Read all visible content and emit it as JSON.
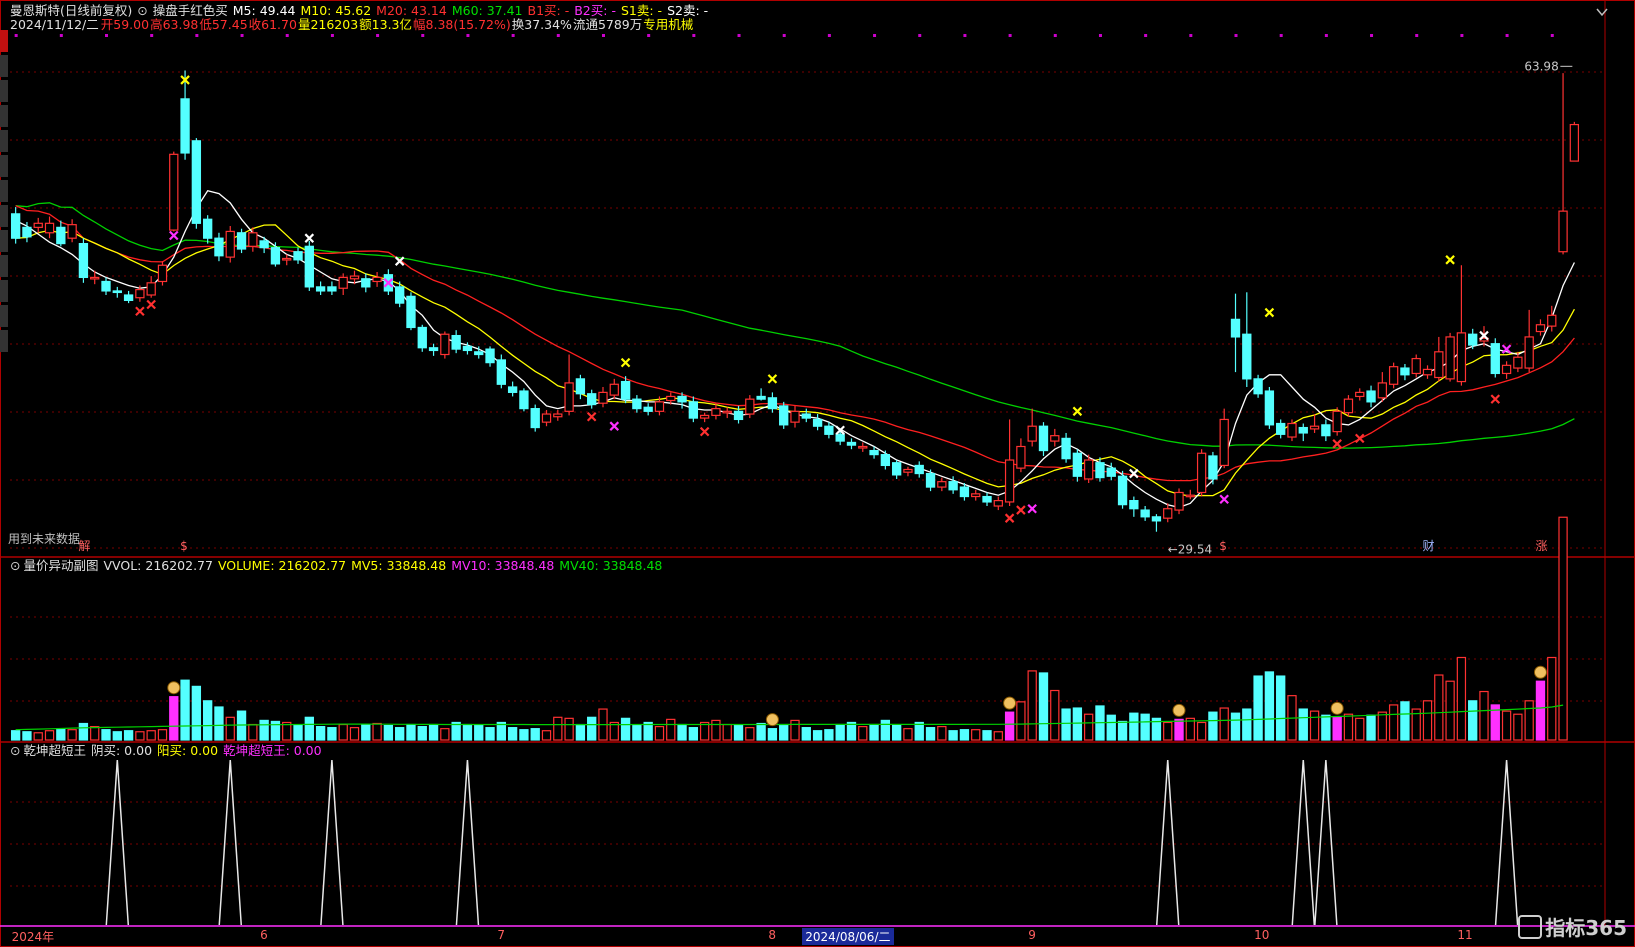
{
  "colors": {
    "up": "#ff3232",
    "down": "#54ffff",
    "ma5": "#ffffff",
    "ma10": "#ffff00",
    "ma20": "#ff2020",
    "ma60": "#00d000",
    "grid": "#7a0000",
    "sep": "#b00000",
    "vol_ma": "#00d000",
    "label": "#c8c8c8",
    "sig_cross": "#ffff00",
    "sig_buy": "#ff3030",
    "sig_pink": "#ff30ff"
  },
  "header": {
    "title": "曼恩斯特(日线前复权)",
    "indicator_name": "操盘手红色买",
    "ma5": "M5: 49.44",
    "ma10": "M10: 45.62",
    "ma20": "M20: 43.14",
    "ma60": "M60: 37.41",
    "b1": "B1买: -",
    "b2": "B2买: -",
    "s1": "S1卖: -",
    "s2": "S2卖: -",
    "date": "2024/11/12/二",
    "open": "开59.00",
    "high": "高63.98",
    "low": "低57.45",
    "close": "收61.70",
    "volume": "量216203",
    "amount": "额13.3亿",
    "change": "幅8.38(15.72%)",
    "turnover": "换37.34%",
    "float": "流通5789万",
    "industry": "专用机械"
  },
  "volume_header": {
    "name": "量价异动副图",
    "vvol": "VVOL: 216202.77",
    "volume": "VOLUME: 216202.77",
    "mv5": "MV5: 33848.48",
    "mv10": "MV10: 33848.48",
    "mv40": "MV40: 33848.48"
  },
  "osc_header": {
    "name": "乾坤超短王",
    "yin": "阴买: 0.00",
    "yang": "阳买: 0.00",
    "king": "乾坤超短王: 0.00"
  },
  "future_note": "用到未来数据",
  "x_axis_labels": [
    {
      "label": "2024年",
      "i": 0
    },
    {
      "label": "6",
      "i": 22
    },
    {
      "label": "7",
      "i": 43
    },
    {
      "label": "8",
      "i": 67
    },
    {
      "label": "2024/08/06/二",
      "i": 70,
      "sel": true
    },
    {
      "label": "9",
      "i": 90
    },
    {
      "label": "10",
      "i": 110
    },
    {
      "label": "11",
      "i": 128
    }
  ],
  "bottom_tags": [
    {
      "label": "解",
      "i": 6
    },
    {
      "label": "$",
      "i": 15
    },
    {
      "label": "$",
      "i": 107
    },
    {
      "label": "财",
      "i": 125
    },
    {
      "label": "涨",
      "i": 135
    }
  ],
  "price_labels": {
    "high": "63.98",
    "low": "29.54"
  },
  "side_tabs": [
    true,
    false,
    false,
    false,
    false,
    false,
    false,
    false,
    false,
    false,
    false,
    false,
    false
  ],
  "watermark": "指标365",
  "chart_data": {
    "type": "candlestick",
    "ylim": [
      28.0,
      66.0
    ],
    "candles": [
      [
        53.0,
        51.2,
        53.5,
        50.8
      ],
      [
        52.0,
        51.3,
        52.4,
        50.9
      ],
      [
        52.0,
        52.3,
        52.7,
        51.6
      ],
      [
        51.6,
        52.3,
        52.8,
        51.2
      ],
      [
        52.0,
        50.8,
        52.5,
        50.6
      ],
      [
        51.2,
        52.2,
        52.6,
        50.9
      ],
      [
        50.8,
        48.3,
        51.2,
        47.9
      ],
      [
        48.3,
        48.3,
        48.8,
        47.8
      ],
      [
        48.0,
        47.3,
        48.3,
        47.0
      ],
      [
        47.3,
        47.2,
        47.6,
        46.8
      ],
      [
        47.0,
        46.6,
        47.3,
        46.4
      ],
      [
        46.8,
        47.4,
        47.7,
        46.5
      ],
      [
        47.0,
        47.9,
        48.4,
        46.8
      ],
      [
        48.0,
        49.2,
        49.5,
        47.7
      ],
      [
        51.8,
        57.4,
        57.6,
        51.7
      ],
      [
        61.5,
        57.5,
        63.6,
        57.0
      ],
      [
        58.4,
        52.3,
        58.6,
        51.9
      ],
      [
        52.6,
        51.2,
        52.9,
        50.8
      ],
      [
        51.2,
        49.9,
        51.6,
        49.5
      ],
      [
        49.8,
        51.7,
        52.1,
        49.4
      ],
      [
        51.6,
        50.4,
        51.9,
        50.1
      ],
      [
        50.6,
        51.6,
        52.0,
        50.2
      ],
      [
        51.0,
        50.5,
        51.3,
        50.1
      ],
      [
        50.5,
        49.3,
        50.9,
        49.1
      ],
      [
        49.6,
        49.7,
        50.0,
        49.2
      ],
      [
        50.2,
        49.6,
        50.5,
        49.3
      ],
      [
        50.6,
        47.6,
        51.0,
        47.3
      ],
      [
        47.6,
        47.3,
        48.0,
        47.0
      ],
      [
        47.6,
        47.3,
        48.0,
        47.0
      ],
      [
        47.5,
        48.3,
        48.6,
        47.0
      ],
      [
        48.2,
        48.4,
        48.8,
        47.8
      ],
      [
        48.2,
        47.6,
        48.6,
        47.2
      ],
      [
        48.0,
        48.3,
        48.7,
        47.6
      ],
      [
        48.5,
        47.3,
        48.9,
        47.0
      ],
      [
        47.6,
        46.4,
        48.0,
        46.1
      ],
      [
        46.9,
        44.6,
        47.2,
        44.4
      ],
      [
        44.6,
        43.1,
        44.8,
        42.8
      ],
      [
        43.1,
        42.9,
        43.4,
        42.5
      ],
      [
        42.6,
        44.1,
        44.3,
        42.3
      ],
      [
        44.0,
        43.0,
        44.4,
        42.7
      ],
      [
        43.2,
        42.9,
        43.5,
        42.6
      ],
      [
        42.8,
        42.6,
        43.2,
        42.3
      ],
      [
        43.0,
        42.0,
        43.2,
        41.7
      ],
      [
        42.2,
        40.4,
        42.6,
        40.1
      ],
      [
        40.2,
        39.8,
        40.6,
        39.5
      ],
      [
        39.9,
        38.6,
        40.1,
        38.4
      ],
      [
        38.6,
        37.2,
        38.9,
        36.9
      ],
      [
        37.6,
        38.2,
        38.5,
        37.3
      ],
      [
        38.0,
        38.2,
        38.5,
        37.7
      ],
      [
        38.4,
        40.5,
        42.6,
        38.1
      ],
      [
        40.8,
        39.7,
        41.1,
        39.3
      ],
      [
        39.7,
        38.9,
        40.0,
        38.6
      ],
      [
        39.0,
        39.8,
        40.2,
        38.7
      ],
      [
        39.6,
        40.4,
        40.8,
        39.3
      ],
      [
        40.6,
        39.3,
        41.0,
        39.0
      ],
      [
        39.3,
        38.6,
        39.6,
        38.3
      ],
      [
        38.7,
        38.4,
        39.0,
        38.1
      ],
      [
        38.4,
        39.1,
        39.5,
        38.1
      ],
      [
        39.2,
        39.5,
        39.8,
        38.9
      ],
      [
        39.5,
        39.1,
        39.8,
        38.6
      ],
      [
        39.1,
        37.9,
        39.5,
        37.6
      ],
      [
        37.9,
        38.1,
        38.3,
        37.6
      ],
      [
        38.1,
        38.6,
        39.0,
        37.8
      ],
      [
        38.3,
        38.4,
        38.7,
        37.9
      ],
      [
        38.4,
        37.8,
        38.8,
        37.5
      ],
      [
        38.2,
        39.3,
        39.6,
        37.9
      ],
      [
        39.5,
        39.3,
        40.1,
        39.2
      ],
      [
        39.4,
        38.6,
        39.8,
        38.3
      ],
      [
        38.8,
        37.4,
        39.1,
        37.1
      ],
      [
        37.6,
        38.4,
        38.8,
        37.2
      ],
      [
        38.2,
        37.9,
        38.6,
        37.6
      ],
      [
        37.8,
        37.3,
        38.2,
        37.0
      ],
      [
        37.3,
        36.7,
        37.6,
        36.4
      ],
      [
        36.7,
        36.2,
        37.0,
        35.9
      ],
      [
        36.1,
        35.9,
        36.4,
        35.6
      ],
      [
        35.8,
        35.8,
        36.1,
        35.4
      ],
      [
        35.5,
        35.2,
        35.8,
        34.9
      ],
      [
        35.2,
        34.4,
        35.5,
        34.1
      ],
      [
        34.6,
        33.7,
        34.8,
        33.4
      ],
      [
        33.9,
        34.1,
        34.3,
        33.6
      ],
      [
        34.4,
        33.8,
        34.7,
        33.5
      ],
      [
        33.8,
        32.8,
        34.1,
        32.5
      ],
      [
        32.8,
        33.2,
        33.5,
        32.5
      ],
      [
        33.2,
        32.6,
        33.6,
        32.3
      ],
      [
        32.8,
        32.1,
        33.1,
        31.8
      ],
      [
        32.1,
        32.3,
        32.6,
        31.8
      ],
      [
        32.1,
        31.7,
        32.4,
        31.4
      ],
      [
        31.4,
        31.8,
        32.1,
        31.1
      ],
      [
        31.7,
        34.8,
        37.8,
        31.4
      ],
      [
        34.2,
        35.8,
        36.4,
        33.9
      ],
      [
        36.2,
        37.3,
        38.6,
        35.8
      ],
      [
        37.3,
        35.5,
        37.6,
        35.1
      ],
      [
        36.2,
        36.6,
        37.1,
        35.8
      ],
      [
        36.4,
        34.9,
        36.8,
        34.6
      ],
      [
        35.3,
        33.6,
        35.6,
        33.2
      ],
      [
        33.4,
        34.8,
        35.2,
        33.1
      ],
      [
        34.6,
        33.5,
        35.0,
        33.2
      ],
      [
        34.2,
        33.6,
        34.6,
        33.3
      ],
      [
        33.6,
        31.5,
        34.0,
        31.2
      ],
      [
        31.8,
        31.2,
        32.1,
        30.6
      ],
      [
        31.1,
        30.6,
        31.4,
        30.3
      ],
      [
        30.6,
        30.3,
        30.8,
        29.5
      ],
      [
        30.5,
        31.2,
        31.6,
        30.2
      ],
      [
        31.1,
        32.4,
        32.7,
        30.8
      ],
      [
        32.2,
        32.2,
        32.6,
        31.9
      ],
      [
        32.4,
        35.3,
        35.6,
        32.1
      ],
      [
        35.1,
        33.4,
        35.4,
        33.0
      ],
      [
        34.4,
        37.8,
        38.6,
        34.2
      ],
      [
        45.2,
        43.9,
        47.1,
        41.3
      ],
      [
        44.1,
        40.8,
        47.2,
        40.2
      ],
      [
        40.8,
        39.7,
        41.1,
        39.4
      ],
      [
        39.9,
        37.4,
        40.2,
        37.1
      ],
      [
        37.5,
        36.7,
        37.8,
        36.4
      ],
      [
        36.5,
        37.5,
        37.8,
        36.2
      ],
      [
        37.2,
        36.8,
        37.5,
        36.2
      ],
      [
        37.1,
        37.3,
        38.2,
        36.8
      ],
      [
        37.4,
        36.6,
        37.8,
        36.2
      ],
      [
        36.9,
        38.4,
        38.7,
        36.6
      ],
      [
        38.3,
        39.3,
        39.6,
        38.0
      ],
      [
        39.5,
        39.8,
        40.1,
        39.2
      ],
      [
        39.9,
        39.1,
        40.3,
        38.7
      ],
      [
        39.4,
        40.5,
        41.3,
        39.1
      ],
      [
        40.4,
        41.7,
        42.0,
        40.1
      ],
      [
        41.6,
        41.1,
        41.9,
        40.7
      ],
      [
        41.2,
        42.3,
        42.6,
        40.9
      ],
      [
        41.1,
        41.5,
        41.8,
        40.8
      ],
      [
        40.9,
        42.8,
        43.9,
        40.6
      ],
      [
        40.8,
        43.9,
        44.2,
        40.6
      ],
      [
        40.6,
        44.2,
        49.2,
        40.3
      ],
      [
        44.1,
        43.3,
        44.5,
        43.0
      ],
      [
        43.6,
        43.8,
        44.7,
        43.2
      ],
      [
        43.4,
        41.2,
        43.8,
        40.9
      ],
      [
        41.2,
        41.8,
        42.1,
        40.8
      ],
      [
        41.6,
        42.4,
        42.8,
        41.3
      ],
      [
        41.6,
        43.9,
        45.9,
        41.3
      ],
      [
        44.3,
        44.8,
        45.2,
        44.0
      ],
      [
        44.7,
        45.5,
        46.2,
        44.3
      ],
      [
        50.2,
        53.2,
        63.4,
        50.0
      ],
      [
        56.9,
        59.6,
        59.8,
        57.2
      ]
    ],
    "ma5": [
      52.5,
      52.1,
      51.5,
      50.9,
      50.5,
      50.0,
      49.3,
      48.7,
      48.3,
      48.0,
      47.7,
      47.5,
      47.6,
      48.5,
      49.8,
      51.7,
      53.4,
      54.7,
      54.5,
      53.8,
      52.6,
      51.6,
      51.2,
      50.6,
      50.0,
      49.7,
      49.2,
      48.7,
      48.2,
      48.0,
      47.9,
      48.1,
      48.2,
      48.0,
      47.3,
      46.2,
      45.5,
      44.4,
      43.8,
      43.5,
      43.3,
      43.0,
      42.6,
      41.9,
      41.3,
      40.6,
      39.6,
      38.8,
      38.6,
      38.8,
      38.8,
      38.9,
      39.1,
      39.4,
      39.2,
      39.2,
      39.1,
      39.1,
      39.0,
      38.9,
      38.6,
      38.5,
      38.5,
      38.3,
      38.1,
      38.2,
      38.6,
      38.9,
      38.5,
      38.2,
      38.0,
      37.9,
      37.6,
      37.1,
      36.6,
      36.2,
      35.8,
      35.3,
      34.8,
      34.5,
      34.2,
      33.9,
      33.6,
      33.3,
      33.0,
      32.7,
      32.4,
      32.2,
      32.5,
      33.2,
      34.0,
      34.9,
      35.6,
      36.0,
      35.6,
      35.0,
      34.6,
      34.3,
      33.7,
      33.0,
      32.4,
      31.9,
      31.5,
      31.3,
      31.6,
      32.5,
      33.3,
      34.7,
      37.5,
      39.6,
      40.5,
      41.1,
      41.1,
      40.2,
      39.3,
      38.7,
      37.9,
      37.5,
      37.4,
      37.8,
      38.5,
      39.2,
      39.9,
      40.3,
      40.8,
      41.3,
      41.6,
      42.1,
      42.9,
      43.2,
      43.4,
      43.0,
      42.8,
      42.6,
      43.0,
      43.4,
      45.3,
      47.7,
      49.4
    ]
  },
  "signals": {
    "yellow_x": [
      {
        "i": 15,
        "y": 62.9
      },
      {
        "i": 54,
        "y": 42.0
      },
      {
        "i": 67,
        "y": 40.8
      },
      {
        "i": 94,
        "y": 38.4
      },
      {
        "i": 111,
        "y": 45.7
      },
      {
        "i": 127,
        "y": 49.6
      }
    ],
    "red_x": [
      {
        "i": 11,
        "y": 45.8
      },
      {
        "i": 12,
        "y": 46.3
      },
      {
        "i": 51,
        "y": 38.0
      },
      {
        "i": 61,
        "y": 36.9
      },
      {
        "i": 88,
        "y": 30.5
      },
      {
        "i": 89,
        "y": 31.1
      },
      {
        "i": 117,
        "y": 36.0
      },
      {
        "i": 119,
        "y": 36.4
      },
      {
        "i": 131,
        "y": 39.3
      }
    ],
    "white_x": [
      {
        "i": 26,
        "y": 51.2
      },
      {
        "i": 34,
        "y": 49.5
      },
      {
        "i": 73,
        "y": 37.0
      },
      {
        "i": 99,
        "y": 33.8
      },
      {
        "i": 130,
        "y": 44.0
      }
    ],
    "pink_x": [
      {
        "i": 14,
        "y": 51.4
      },
      {
        "i": 33,
        "y": 47.9
      },
      {
        "i": 53,
        "y": 37.3
      },
      {
        "i": 90,
        "y": 31.2
      },
      {
        "i": 107,
        "y": 31.9
      },
      {
        "i": 132,
        "y": 43.0
      }
    ]
  },
  "volume_data": {
    "ylim": [
      0,
      160000
    ],
    "values": [
      9000,
      8000,
      7000,
      9000,
      11000,
      10000,
      16000,
      13000,
      10000,
      8000,
      9000,
      8000,
      9000,
      10000,
      42000,
      58000,
      52000,
      38000,
      32000,
      22000,
      28000,
      15000,
      19000,
      18000,
      17000,
      14000,
      22000,
      13000,
      12000,
      15000,
      12000,
      15000,
      16000,
      14000,
      12000,
      15000,
      13000,
      15000,
      11000,
      17000,
      15000,
      14000,
      12000,
      17000,
      12000,
      10000,
      11000,
      9000,
      22000,
      21000,
      15000,
      22000,
      30000,
      17000,
      21000,
      14000,
      17000,
      13000,
      20000,
      15000,
      12000,
      17000,
      19000,
      15000,
      14000,
      12000,
      16000,
      11000,
      15000,
      19000,
      12000,
      9000,
      10000,
      15000,
      17000,
      13000,
      15000,
      19000,
      14000,
      11000,
      17000,
      12000,
      13000,
      9000,
      10000,
      10000,
      9000,
      8000,
      27000,
      37000,
      67000,
      65000,
      48000,
      30000,
      31000,
      25000,
      33000,
      24000,
      18000,
      26000,
      25000,
      21000,
      17000,
      20000,
      21000,
      17000,
      27000,
      31000,
      26000,
      30000,
      62000,
      66000,
      62000,
      43000,
      30000,
      28000,
      24000,
      22000,
      25000,
      21000,
      24000,
      27000,
      34000,
      37000,
      30000,
      38000,
      63000,
      57000,
      80000,
      38000,
      47000,
      34000,
      28000,
      25000,
      38000,
      57000,
      80000,
      216000
    ],
    "mv40": [
      10000,
      10300,
      10600,
      10900,
      11200,
      11500,
      11800,
      12000,
      12200,
      12400,
      12600,
      12800,
      13000,
      13200,
      13400,
      13600,
      13800,
      14000,
      14200,
      14400,
      14500,
      14600,
      14700,
      14800,
      14900,
      15000,
      15100,
      15200,
      15300,
      15400,
      15400,
      15400,
      15300,
      15300,
      15200,
      15200,
      15100,
      15100,
      15000,
      15000,
      15000,
      15000,
      15000,
      15000,
      15000,
      15000,
      14900,
      14900,
      14900,
      14900,
      14900,
      14900,
      14900,
      14900,
      14900,
      15000,
      15000,
      15000,
      15000,
      15000,
      15000,
      15000,
      15000,
      15000,
      15000,
      15000,
      15000,
      15000,
      15000,
      15100,
      15100,
      15100,
      15100,
      15100,
      15100,
      15100,
      15100,
      15100,
      15100,
      15100,
      15100,
      15100,
      15100,
      15100,
      15100,
      15200,
      15200,
      15200,
      15300,
      15400,
      15600,
      15800,
      16000,
      16200,
      16400,
      16600,
      16800,
      17000,
      17200,
      17400,
      17600,
      17800,
      18000,
      18200,
      18400,
      18600,
      18800,
      19000,
      19300,
      19600,
      20000,
      20400,
      20800,
      21200,
      21600,
      22000,
      22400,
      22800,
      23200,
      23600,
      24000,
      24400,
      24800,
      25200,
      25600,
      26000,
      26500,
      27000,
      27500,
      28000,
      28500,
      29000,
      29500,
      30000,
      30500,
      31000,
      32000,
      33848
    ],
    "pink_bars": [
      14,
      88,
      103,
      117,
      131,
      135
    ],
    "money_icons": [
      14,
      67,
      88,
      103,
      117,
      135
    ]
  },
  "oscillator": {
    "ylim": [
      0,
      1
    ],
    "spikes": [
      9,
      19,
      28,
      40,
      102,
      114,
      116,
      132
    ]
  }
}
